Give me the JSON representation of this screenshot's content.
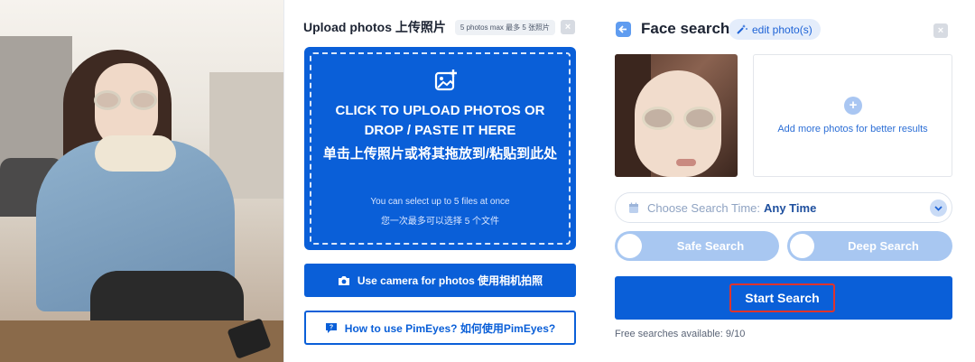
{
  "upload": {
    "title": "Upload photos 上传照片",
    "badge": "5 photos max 最多 5 张照片",
    "close_icon": "×",
    "drop_en": "CLICK TO UPLOAD PHOTOS OR DROP / PASTE IT HERE",
    "drop_cn": "单击上传照片或将其拖放到/粘贴到此处",
    "drop_sub_en": "You can select up to 5 files at once",
    "drop_sub_cn": "您一次最多可以选择 5 个文件",
    "camera_label": "Use camera for photos 使用相机拍照",
    "howto_label": "How to use PimEyes? 如何使用PimEyes?"
  },
  "face_search": {
    "title": "Face search",
    "edit_label": "edit photo(s)",
    "close_icon": "×",
    "add_more_label": "Add more photos for better results",
    "add_icon": "+",
    "time_label": "Choose Search Time:",
    "time_value": "Any Time",
    "chevron": "⌄",
    "safe_search_label": "Safe Search",
    "deep_search_label": "Deep Search",
    "start_label": "Start Search",
    "free_searches": "Free searches available:  9/10"
  },
  "colors": {
    "primary": "#0a5fd8",
    "toggle": "#a8c7f1",
    "highlight_border": "#e0332b"
  },
  "icons": {
    "upload": "image-upload-icon",
    "camera": "camera-icon",
    "help": "help-chat-icon",
    "back": "back-arrow-icon",
    "edit": "magic-wand-icon",
    "calendar": "calendar-icon"
  }
}
